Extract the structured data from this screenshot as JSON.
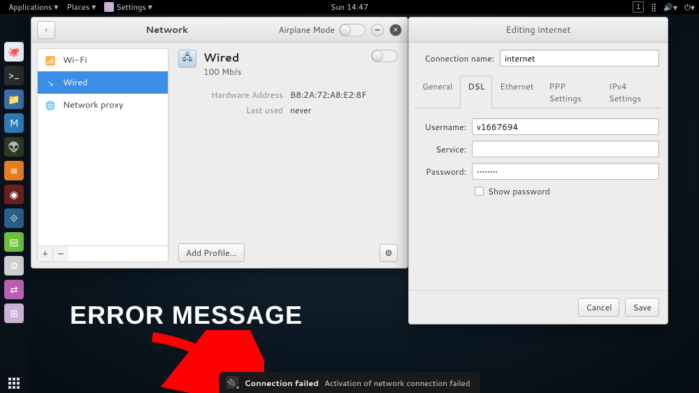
{
  "topbar": {
    "menus": [
      "Applications",
      "Places",
      "Settings"
    ],
    "clock": "Sun 14:47",
    "workspace": "1"
  },
  "dock_items": [
    {
      "name": "octopus-icon",
      "bg": "#e8eef5",
      "glyph": "🐙"
    },
    {
      "name": "terminal-icon",
      "bg": "#2b2b2b",
      "glyph": ">_"
    },
    {
      "name": "files-icon",
      "bg": "#3b6ea5",
      "glyph": "📁"
    },
    {
      "name": "metasploit-icon",
      "bg": "#2e7bb8",
      "glyph": "M"
    },
    {
      "name": "armitage-icon",
      "bg": "#2d3a1e",
      "glyph": "👽"
    },
    {
      "name": "burp-icon",
      "bg": "#e67e22",
      "glyph": "≡"
    },
    {
      "name": "zenmap-icon",
      "bg": "#6b1f1f",
      "glyph": "◉"
    },
    {
      "name": "kismet-icon",
      "bg": "#2a5f8a",
      "glyph": "⟐"
    },
    {
      "name": "notes-icon",
      "bg": "#6fbf3f",
      "glyph": "▤"
    },
    {
      "name": "settings-icon",
      "bg": "#d0d0d0",
      "glyph": "⚙"
    },
    {
      "name": "tweaks-icon",
      "bg": "#b85fb0",
      "glyph": "⇄"
    },
    {
      "name": "other-settings-icon",
      "bg": "#c9b2d6",
      "glyph": "⊞"
    }
  ],
  "network_window": {
    "title": "Network",
    "airplane_label": "Airplane Mode",
    "sidebar": [
      {
        "icon": "📶",
        "label": "Wi-Fi",
        "name": "sidebar-item-wifi"
      },
      {
        "icon": "↘",
        "label": "Wired",
        "name": "sidebar-item-wired",
        "selected": true
      },
      {
        "icon": "🌐",
        "label": "Network proxy",
        "name": "sidebar-item-proxy"
      }
    ],
    "detail": {
      "title": "Wired",
      "speed": "100 Mb/s",
      "rows": [
        {
          "k": "Hardware Address",
          "v": "B8:2A:72:A8:E2:8F"
        },
        {
          "k": "Last used",
          "v": "never"
        }
      ],
      "add_profile": "Add Profile…"
    }
  },
  "edit_dialog": {
    "title": "Editing internet",
    "conn_name_label": "Connection name:",
    "conn_name_value": "internet",
    "tabs": [
      "General",
      "DSL",
      "Ethernet",
      "PPP Settings",
      "IPv4 Settings"
    ],
    "active_tab": "DSL",
    "fields": {
      "username_label": "Username:",
      "username_value": "v1667694",
      "service_label": "Service:",
      "service_value": "",
      "password_label": "Password:",
      "password_value": "••••••••",
      "show_pw_label": "Show password"
    },
    "buttons": {
      "cancel": "Cancel",
      "save": "Save"
    }
  },
  "annotation_text": "ERROR MESSAGE",
  "toast": {
    "title": "Connection failed",
    "body": "Activation of network connection failed"
  }
}
